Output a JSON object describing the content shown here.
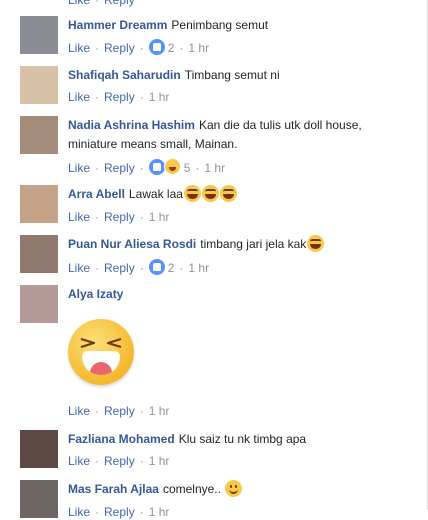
{
  "labels": {
    "like": "Like",
    "reply": "Reply"
  },
  "comments": [
    {
      "name": "",
      "text": "",
      "like": "Like",
      "reply": "Reply",
      "count": "",
      "time": "",
      "avatar": "#c9ccd1"
    },
    {
      "name": "Hammer Dreamm",
      "text": "Penimbang semut",
      "count": "2",
      "time": "1 hr",
      "avatar": "#8a8d93"
    },
    {
      "name": "Shafiqah Saharudin",
      "text": "Timbang semut ni",
      "count": "",
      "time": "1 hr",
      "avatar": "#d7c2a8"
    },
    {
      "name": "Nadia Ashrina Hashim",
      "text": "Kan die da tulis utk doll house, miniature means small, Mainan.",
      "count": "5",
      "time": "1 hr",
      "avatar": "#a48d7c"
    },
    {
      "name": "Arra Abell",
      "text": "Lawak laa",
      "count": "",
      "time": "1 hr",
      "avatar": "#c4a389"
    },
    {
      "name": "Puan Nur Aliesa Rosdi",
      "text": "timbang jari jela kak",
      "count": "2",
      "time": "1 hr",
      "avatar": "#8f7a6d"
    },
    {
      "name": "Alya Izaty",
      "text": "",
      "count": "",
      "time": "1 hr",
      "avatar": "#b39a96"
    },
    {
      "name": "Fazliana Mohamed",
      "text": "Klu saiz tu nk timbg apa",
      "count": "",
      "time": "1 hr",
      "avatar": "#5b4a45"
    },
    {
      "name": "Mas Farah Ajlaa",
      "text": "comelnye..",
      "count": "",
      "time": "1 hr",
      "avatar": "#6e6663"
    }
  ],
  "icons": {
    "like_reaction": "like-reaction-icon",
    "haha_reaction": "haha-reaction-icon",
    "laugh_emoji": "laughing-emoji-icon",
    "smile_emoji": "smile-emoji-icon",
    "sticker": "laughing-sticker"
  },
  "colors": {
    "name": "#365899",
    "link": "#4267b2",
    "meta": "#90949c",
    "like_badge": "#5890ff"
  }
}
